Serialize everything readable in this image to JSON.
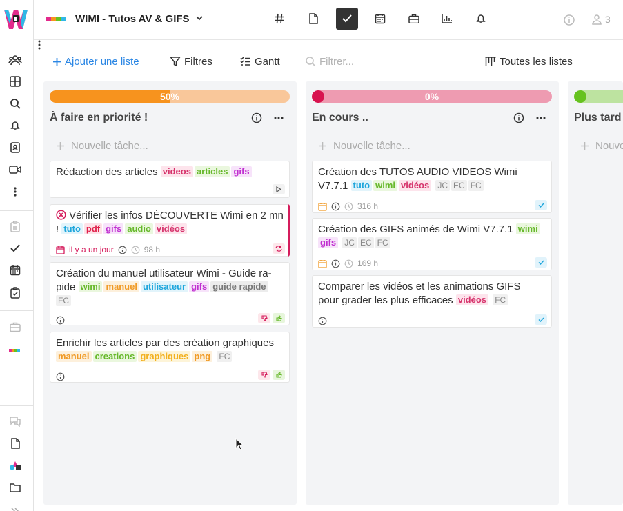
{
  "header": {
    "workspace_title": "WIMI - Tutos AV & GIFS",
    "user_count": "3",
    "colors": {
      "active_tab": "#333333",
      "accent": "#2a86e4"
    }
  },
  "toolbar": {
    "add_list": "Ajouter une liste",
    "filters": "Filtres",
    "gantt": "Gantt",
    "search_placeholder": "Filtrer...",
    "all_lists": "Toutes les listes"
  },
  "columns": [
    {
      "progress_label": "50%",
      "progress_value": 50,
      "progress_color": "#f7931e",
      "progress_track": "#f9c79a",
      "title": "À faire en priorité !",
      "new_task": "Nouvelle tâche..."
    },
    {
      "progress_label": "0%",
      "progress_value": 0,
      "progress_color": "#d8134f",
      "progress_track": "#ee9bb1",
      "title": "En cours ..",
      "new_task": "Nouvelle tâche..."
    },
    {
      "progress_color": "#66c21f",
      "progress_track": "#bde3a0",
      "title": "Plus tard",
      "new_task": "Nouvelle tâche..."
    }
  ],
  "cards": {
    "c1": {
      "title": "Rédaction des articles",
      "tags": [
        "videos",
        "articles",
        "gifs"
      ]
    },
    "c2": {
      "title": "Vérifier les infos DÉCOUVERTE Wimi en 2 mn !",
      "tags": [
        "tuto",
        "pdf",
        "gifs",
        "audio",
        "vidéos"
      ],
      "date": "il y a un jour",
      "duration": "98 h"
    },
    "c3": {
      "title_a": "Création du manuel utilisateur Wimi - Guide ra-",
      "title_b": "pide",
      "tags": [
        "wimi",
        "manuel",
        "utilisateur",
        "gifs",
        "guide rapide"
      ],
      "initials": [
        "FC"
      ]
    },
    "c4": {
      "title": "Enrichir les articles par des création graphiques",
      "tags": [
        "manuel",
        "creations",
        "graphiques",
        "png"
      ],
      "initials": [
        "FC"
      ]
    },
    "c5": {
      "title_a": "Création des TUTOS AUDIO VIDEOS Wimi",
      "title_b": "V7.7.1",
      "tags": [
        "tuto",
        "wimi",
        "vidéos"
      ],
      "initials": [
        "JC",
        "EC",
        "FC"
      ],
      "duration": "316 h"
    },
    "c6": {
      "title": "Création des GIFS animés de Wimi V7.7.1",
      "tags": [
        "wimi",
        "gifs"
      ],
      "initials": [
        "JC",
        "EC",
        "FC"
      ],
      "duration": "169 h"
    },
    "c7": {
      "title_a": "Comparer les vidéos et les animations GIFS",
      "title_b": "pour grader les plus efficaces",
      "tags": [
        "vidéos"
      ],
      "initials": [
        "FC"
      ]
    }
  }
}
